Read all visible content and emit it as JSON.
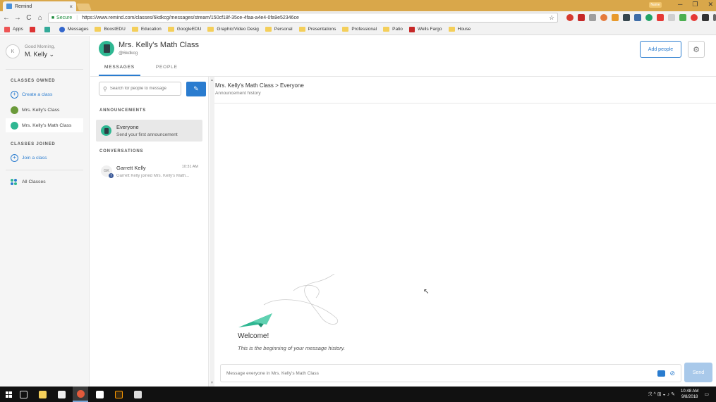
{
  "browser": {
    "tab_title": "Remind",
    "tab_close": "×",
    "window_user": "Name",
    "win_min": "─",
    "win_max": "❐",
    "win_close": "✕",
    "nav_back": "←",
    "nav_forward": "→",
    "nav_reload": "C",
    "nav_home": "⌂",
    "secure_label": "Secure",
    "url": "https://www.remind.com/classes/6kdkcg/messages/stream/150cf18f-35ce-4faa-a4e4-0fa9e52346ce",
    "star": "☆",
    "bookmarks": [
      "Apps",
      "Messages",
      "BoostEDU",
      "Education",
      "GoogleEDU",
      "Graphic/Video Desig",
      "Personal",
      "Presentations",
      "Professional",
      "Patio",
      "Wells Fargo",
      "House"
    ]
  },
  "sidebar": {
    "greeting": "Good Morning,",
    "user_name": "M. Kelly",
    "avatar_initial": "K",
    "owned_heading": "CLASSES OWNED",
    "create_class": "Create a class",
    "owned_classes": [
      "Mrs. Kelly's Class",
      "Mrs. Kelly's Math Class"
    ],
    "joined_heading": "CLASSES JOINED",
    "join_class": "Join a class",
    "all_classes": "All Classes",
    "plus": "+",
    "chevron": "⌄"
  },
  "header": {
    "class_name": "Mrs. Kelly's Math Class",
    "class_code": "@6kdkcg",
    "tabs": [
      "MESSAGES",
      "PEOPLE"
    ],
    "add_people": "Add people",
    "gear": "⚙"
  },
  "conversations": {
    "search_placeholder": "Search for people to message",
    "search_glyph": "⚲",
    "compose_glyph": "✎",
    "announcements_heading": "ANNOUNCEMENTS",
    "announcement": {
      "title": "Everyone",
      "subtitle": "Send your first announcement"
    },
    "conversations_heading": "CONVERSATIONS",
    "items": [
      {
        "initials": "GK",
        "name": "Garrett Kelly",
        "time": "10:31 AM",
        "preview": "Garrett Kelly joined Mrs. Kelly's Math..."
      }
    ],
    "fb_glyph": "f",
    "scroll_up": "▲",
    "scroll_down": "▼"
  },
  "message_pane": {
    "breadcrumb": "Mrs. Kelly's Math Class > Everyone",
    "subtitle": "Announcement history",
    "welcome_title": "Welcome!",
    "welcome_sub": "This is the beginning of your message history.",
    "composer_placeholder": "Message everyone in Mrs. Kelly's Math Class",
    "clip_glyph": "⊘",
    "send": "Send",
    "cursor": "↖"
  },
  "taskbar": {
    "time": "10:48 AM",
    "date": "9/8/2018",
    "tray_glyphs": "ℛ  ^  ⊞  ◒  ♪  ✎"
  },
  "colors": {
    "accent": "#2a7ccf",
    "class_badge": "#2fb792",
    "send_disabled": "#a9c9ea",
    "titlebar": "#d9a74a"
  }
}
